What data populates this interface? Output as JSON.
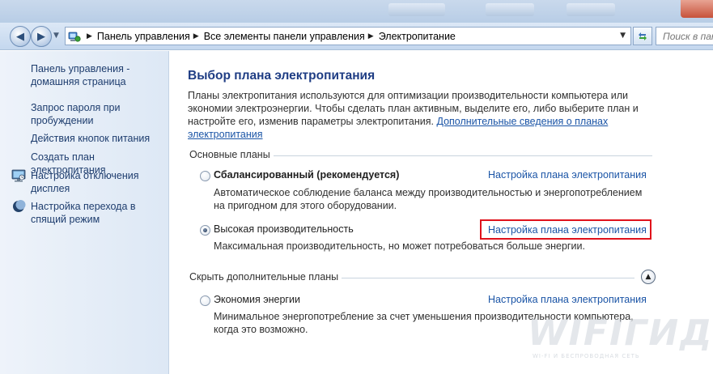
{
  "colors": {
    "link": "#1a54a6",
    "nav_link": "#1e3d6e",
    "title": "#1f3d84",
    "highlight": "#e0121b"
  },
  "navigation": {
    "back_icon": "back-arrow-icon",
    "forward_icon": "forward-arrow-icon",
    "breadcrumbs": [
      "Панель управления",
      "Все элементы панели управления",
      "Электропитание"
    ],
    "search_placeholder": "Поиск в пан"
  },
  "sidebar": {
    "items": [
      {
        "label": "Панель управления - домашняя страница",
        "icon": null
      },
      {
        "label": "Запрос пароля при пробуждении",
        "icon": null
      },
      {
        "label": "Действия кнопок питания",
        "icon": null
      },
      {
        "label": "Создать план электропитания",
        "icon": null
      },
      {
        "label": "Настройка отключения дисплея",
        "icon": "display-icon"
      },
      {
        "label": "Настройка перехода в спящий режим",
        "icon": "moon-icon"
      }
    ]
  },
  "main": {
    "title": "Выбор плана электропитания",
    "intro_text": "Планы электропитания используются для оптимизации производительности компьютера или экономии электроэнергии. Чтобы сделать план активным, выделите его, либо выберите план и настройте его, изменив параметры электропитания. ",
    "intro_link": "Дополнительные сведения о планах электропитания",
    "sections": {
      "main_plans": "Основные планы",
      "hide_plans": "Скрыть дополнительные планы"
    },
    "plans": [
      {
        "name": "Сбалансированный (рекомендуется)",
        "description": "Автоматическое соблюдение баланса между производительностью и энергопотреблением на пригодном для этого оборудовании.",
        "link": "Настройка плана электропитания",
        "selected": false
      },
      {
        "name": "Высокая производительность",
        "description": "Максимальная производительность, но может потребоваться больше энергии.",
        "link": "Настройка плана электропитания",
        "selected": true
      },
      {
        "name": "Экономия энергии",
        "description": "Минимальное энергопотребление за счет уменьшения производительности компьютера, когда это возможно.",
        "link": "Настройка плана электропитания",
        "selected": false
      }
    ]
  },
  "watermark": {
    "title": "WIFIГИД",
    "subtitle": "WI-FI И БЕСПРОВОДНАЯ СЕТЬ"
  }
}
